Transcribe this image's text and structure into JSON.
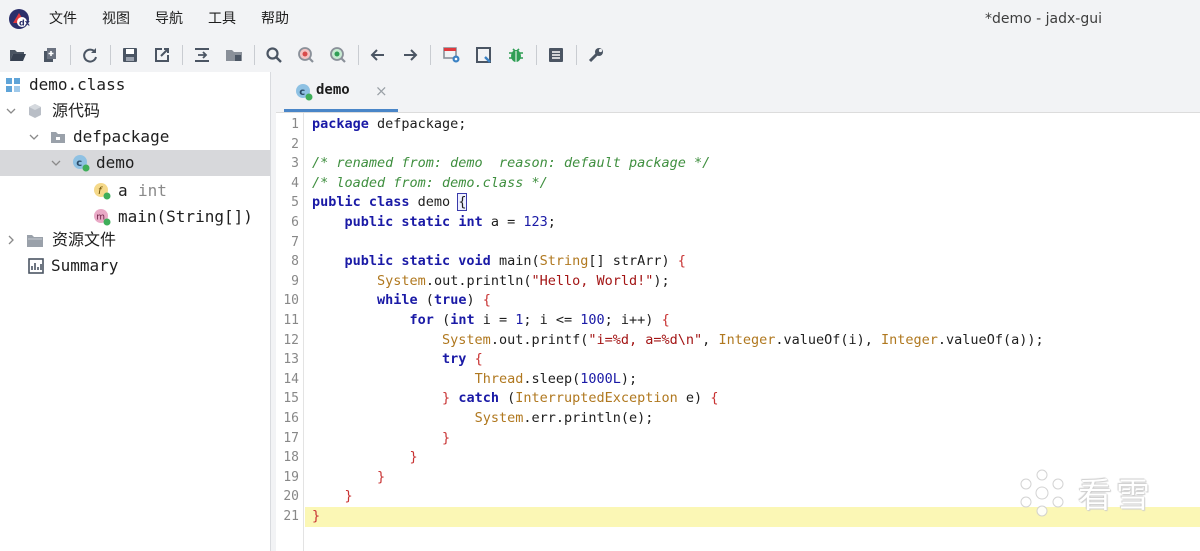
{
  "window": {
    "title": "*demo - jadx-gui"
  },
  "menu": [
    "文件",
    "视图",
    "导航",
    "工具",
    "帮助"
  ],
  "toolbar": {
    "buttons": [
      "open-icon",
      "add-files-icon",
      "sync-icon",
      "save-icon",
      "export-icon",
      "flatten-packages-icon",
      "package-view-icon",
      "search-icon",
      "find-class-icon",
      "find-usage-icon",
      "back-icon",
      "forward-icon",
      "deobfuscation-icon",
      "quick-tabs-icon",
      "debug-icon",
      "log-icon",
      "preferences-icon"
    ]
  },
  "tree": {
    "root": "demo.class",
    "source_code": "源代码",
    "package": "defpackage",
    "class": "demo",
    "field_name": "a",
    "field_type": "int",
    "method": "main(String[])",
    "resources": "资源文件",
    "summary": "Summary"
  },
  "editor": {
    "tab_label": "demo",
    "tab_close": "×",
    "line_numbers": [
      "1",
      "2",
      "3",
      "4",
      "5",
      "6",
      "7",
      "8",
      "9",
      "10",
      "11",
      "12",
      "13",
      "14",
      "15",
      "16",
      "17",
      "18",
      "19",
      "20",
      "21"
    ],
    "current_line": 21,
    "code": {
      "l1_kw": "package",
      "l1_rest": " defpackage;",
      "l3": "/* renamed from: demo  reason: default package */",
      "l4": "/* loaded from: demo.class */",
      "l5_kw": "public class",
      "l5_name": " demo ",
      "l5_brace": "{",
      "l6_ind": "    ",
      "l6_kw": "public static",
      "l6_sp": " ",
      "l6_type": "int",
      "l6_rest": " a = ",
      "l6_num": "123",
      "l6_end": ";",
      "l8_ind": "    ",
      "l8_kw": "public static void",
      "l8_rest": " main(",
      "l8_type": "String",
      "l8_rest2": "[] strArr) ",
      "l8_brace": "{",
      "l9_ind": "        ",
      "l9_type": "System",
      "l9_rest": ".out.println(",
      "l9_str": "\"Hello, World!\"",
      "l9_end": ");",
      "l10_ind": "        ",
      "l10_kw": "while",
      "l10_rest": " (",
      "l10_kw2": "true",
      "l10_rest2": ") ",
      "l10_brace": "{",
      "l11_ind": "            ",
      "l11_kw": "for",
      "l11_rest": " (",
      "l11_kw2": "int",
      "l11_rest2": " i = ",
      "l11_num": "1",
      "l11_rest3": "; i <= ",
      "l11_num2": "100",
      "l11_rest4": "; i++) ",
      "l11_brace": "{",
      "l12_ind": "                ",
      "l12_type": "System",
      "l12_rest": ".out.printf(",
      "l12_str": "\"i=%d, a=%d\\n\"",
      "l12_rest2": ", ",
      "l12_type2": "Integer",
      "l12_rest3": ".valueOf(i), ",
      "l12_type3": "Integer",
      "l12_rest4": ".valueOf(a));",
      "l13_ind": "                ",
      "l13_kw": "try",
      "l13_rest": " ",
      "l13_brace": "{",
      "l14_ind": "                    ",
      "l14_type": "Thread",
      "l14_rest": ".sleep(",
      "l14_num": "1000L",
      "l14_end": ");",
      "l15_ind": "                ",
      "l15_brace": "}",
      "l15_sp": " ",
      "l15_kw": "catch",
      "l15_rest": " (",
      "l15_type": "InterruptedException",
      "l15_rest2": " e) ",
      "l15_brace2": "{",
      "l16_ind": "                    ",
      "l16_type": "System",
      "l16_rest": ".err.println(e);",
      "l17_ind": "                ",
      "l17_brace": "}",
      "l18_ind": "            ",
      "l18_brace": "}",
      "l19_ind": "        ",
      "l19_brace": "}",
      "l20_ind": "    ",
      "l20_brace": "}",
      "l21_brace": "}"
    }
  },
  "watermark": {
    "text": "看雪"
  },
  "colors": {
    "accent": "#4a86c8",
    "current_line": "#fbf7b5",
    "selected_node": "#d7d8db",
    "chrome": "#f2f3f5"
  }
}
